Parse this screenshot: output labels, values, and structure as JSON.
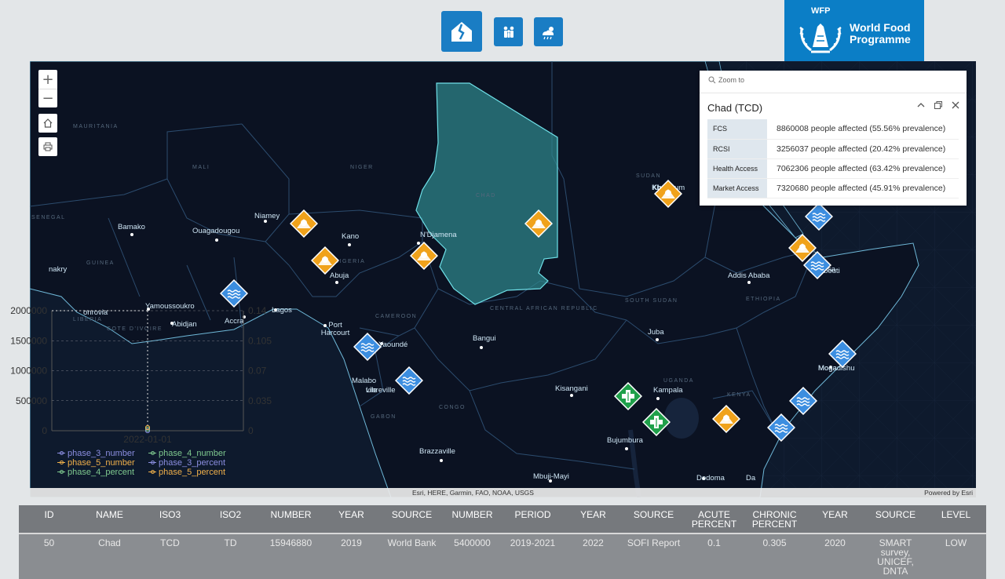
{
  "toolbar": {
    "buttons": [
      {
        "name": "hazard-map-icon",
        "active": true
      },
      {
        "name": "population-icon",
        "active": false
      },
      {
        "name": "weather-icon",
        "active": false
      }
    ]
  },
  "logo": {
    "abbr": "WFP",
    "name_line1": "World Food",
    "name_line2": "Programme"
  },
  "map": {
    "city_labels": [
      "Bamako",
      "Ouagadougou",
      "Niamey",
      "Kano",
      "N'Djamena",
      "Abuja",
      "Yamoussoukro",
      "Abidjan",
      "Accra",
      "Lagos",
      "Port Harcourt",
      "Yaoundé",
      "Bangui",
      "Juba",
      "Addis Ababa",
      "Kampala",
      "Kisangani",
      "Bujumbura",
      "Brazzaville",
      "Mbuji-Mayi",
      "Dodoma",
      "Mogadishu",
      "Khartoum",
      "Malabo",
      "Libreville",
      "Djibouti"
    ],
    "city_label_fragments": [
      "nakry",
      "onrovia",
      "Kh",
      "sa",
      "Moga",
      "vile",
      "Da"
    ],
    "region_labels": [
      "MAURITANIA",
      "MALI",
      "NIGER",
      "CHAD",
      "SUDAN",
      "NIGERIA",
      "GUINEA",
      "CENTRAL AFRICAN REPUBLIC",
      "SOUTH SUDAN",
      "ETHIOPIA",
      "KENYA",
      "GABON",
      "CONGO",
      "UGANDA",
      "SENEGAL",
      "LIBERIA",
      "COTE D'IVOIRE",
      "CAMEROON"
    ],
    "highlight_country": "Chad",
    "markers": [
      {
        "type": "drought",
        "color": "#f0a21b"
      },
      {
        "type": "flood",
        "color": "#3c8ee0"
      },
      {
        "type": "health",
        "color": "#1fa04a"
      }
    ],
    "attribution": "Esri, HERE, Garmin, FAO, NOAA, USGS",
    "powered_by": "Powered by Esri",
    "controls": {
      "zoom_in": "+",
      "zoom_out": "−"
    }
  },
  "popup": {
    "zoom_to": "Zoom to",
    "title": "Chad (TCD)",
    "rows": [
      {
        "key": "FCS",
        "value": "8860008 people affected (55.56% prevalence)"
      },
      {
        "key": "RCSI",
        "value": "3256037 people affected (20.42% prevalence)"
      },
      {
        "key": "Health Access",
        "value": "7062306 people affected (63.42% prevalence)"
      },
      {
        "key": "Market Access",
        "value": "7320680 people affected (45.91% prevalence)"
      }
    ]
  },
  "chart_data": {
    "type": "line",
    "x": [
      "2022-01-01"
    ],
    "left_axis": {
      "ticks": [
        "0",
        "500000",
        "1000000",
        "1500000",
        "2000000"
      ],
      "ylim": [
        0,
        2000000
      ]
    },
    "right_axis": {
      "ticks": [
        "0",
        "0.035",
        "0.07",
        "0.105",
        "0.14"
      ],
      "ylim": [
        0,
        0.14
      ]
    },
    "series": [
      {
        "name": "phase_3_number",
        "axis": "left",
        "values": [
          0
        ],
        "color": "#8b8ee0"
      },
      {
        "name": "phase_4_number",
        "axis": "left",
        "values": [
          0
        ],
        "color": "#7fc98f"
      },
      {
        "name": "phase_5_number",
        "axis": "left",
        "values": [
          0
        ],
        "color": "#f0b04a"
      },
      {
        "name": "phase_3_percent",
        "axis": "right",
        "values": [
          0
        ],
        "color": "#8b8ee0"
      },
      {
        "name": "phase_4_percent",
        "axis": "right",
        "values": [
          0
        ],
        "color": "#7fc98f"
      },
      {
        "name": "phase_5_percent",
        "axis": "right",
        "values": [
          0
        ],
        "color": "#f0b04a"
      }
    ],
    "grid": true,
    "legend_position": "bottom"
  },
  "table": {
    "headers": [
      "ID",
      "NAME",
      "ISO3",
      "ISO2",
      "NUMBER",
      "YEAR",
      "SOURCE",
      "NUMBER",
      "PERIOD",
      "YEAR",
      "SOURCE",
      "ACUTE PERCENT",
      "CHRONIC PERCENT",
      "YEAR",
      "SOURCE",
      "LEVEL"
    ],
    "row": [
      "50",
      "Chad",
      "TCD",
      "TD",
      "15946880",
      "2019",
      "World Bank",
      "5400000",
      "2019-2021",
      "2022",
      "SOFI Report",
      "0.1",
      "0.305",
      "2020",
      "SMART survey, UNICEF, DNTA",
      "LOW"
    ]
  }
}
